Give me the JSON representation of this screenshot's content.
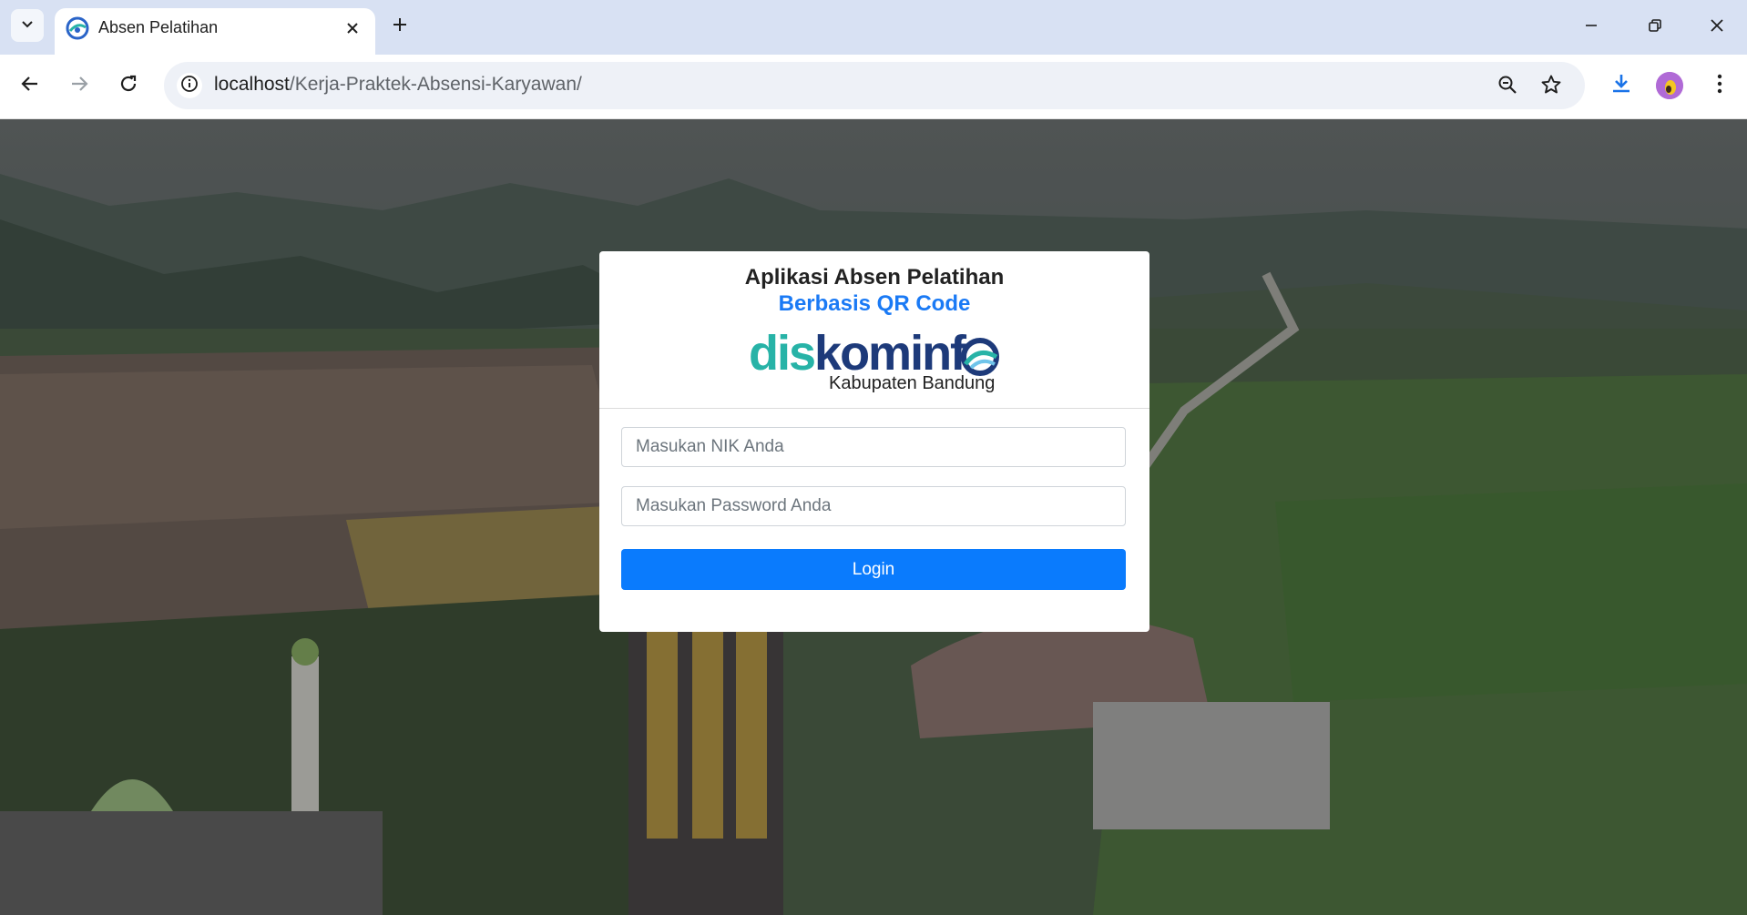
{
  "browser": {
    "tab": {
      "title": "Absen Pelatihan"
    },
    "address": {
      "host": "localhost",
      "path": "/Kerja-Praktek-Absensi-Karyawan/"
    }
  },
  "card": {
    "title": "Aplikasi Absen Pelatihan",
    "subtitle": "Berbasis QR Code",
    "logo": {
      "part1": "dis",
      "part2": "kominf",
      "tagline": "Kabupaten Bandung"
    }
  },
  "form": {
    "nik_placeholder": "Masukan NIK Anda",
    "password_placeholder": "Masukan Password Anda",
    "login_label": "Login"
  },
  "colors": {
    "accent": "#0a7bfd",
    "subtitle": "#1a7af5",
    "logo_teal": "#27b3a7",
    "logo_navy": "#1d3a7a"
  }
}
